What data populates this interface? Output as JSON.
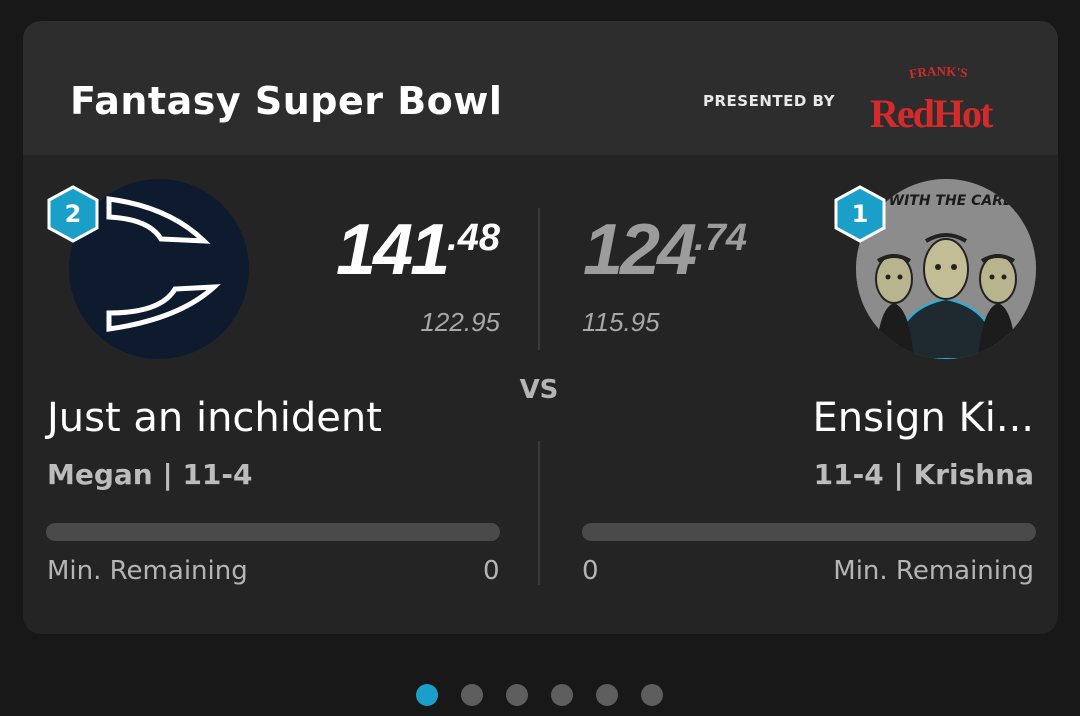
{
  "card": {
    "title": "Fantasy Super Bowl",
    "presented_by": "PRESENTED BY",
    "sponsor": {
      "name": "Frank's RedHot",
      "brand": "FRANK'S",
      "logo_text": "RedHot",
      "color": "#d42a2a"
    }
  },
  "matchup": {
    "vs_label": "VS",
    "left": {
      "seed": "2",
      "score_int": "141",
      "score_dec": ".48",
      "projected": "122.95",
      "team_name": "Just an inchident",
      "owner_record": "Megan | 11-4",
      "progress": 0,
      "min_remaining_label": "Min. Remaining",
      "min_remaining_value": "0"
    },
    "right": {
      "seed": "1",
      "avatar_text": "EPING UP WITH THE CARDASSIANS",
      "score_int": "124",
      "score_dec": ".74",
      "projected": "115.95",
      "team_name": "Ensign Ki...",
      "owner_record": "11-4 | Krishna",
      "progress": 0,
      "min_remaining_label": "Min. Remaining",
      "min_remaining_value": "0"
    }
  },
  "pager": {
    "count": 6,
    "active_index": 0,
    "active_color": "#1aa0c8"
  },
  "colors": {
    "accent": "#1aa0c8",
    "card": "#242424",
    "header": "#2d2d2d"
  }
}
